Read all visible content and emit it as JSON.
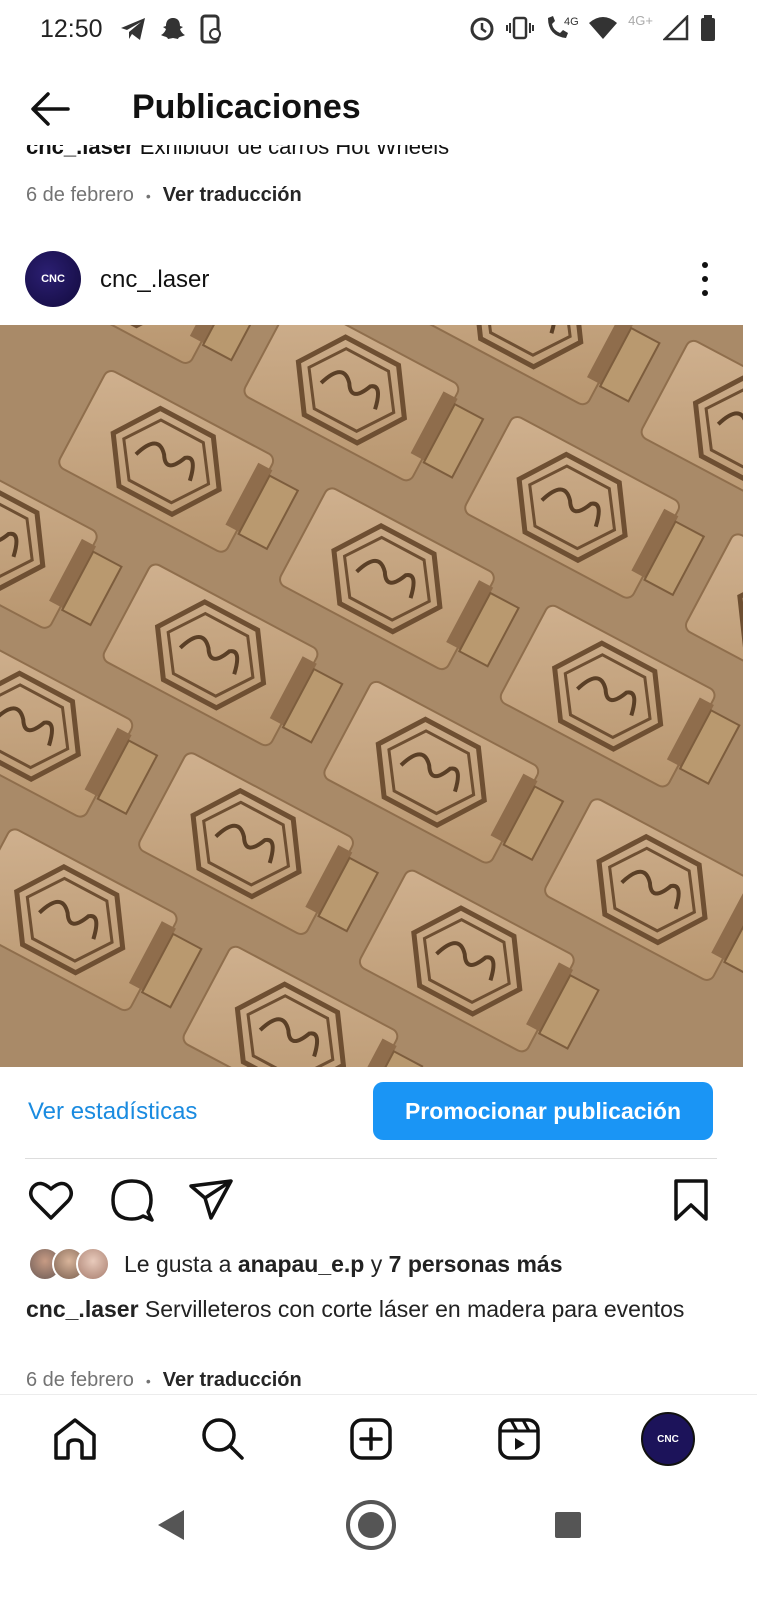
{
  "status_bar": {
    "time": "12:50",
    "network_1": "4G",
    "network_2": "4G+",
    "left_icons": [
      "telegram-icon",
      "snapchat-icon",
      "phone-sync-icon"
    ],
    "right_icons": [
      "alarm-icon",
      "vibrate-icon",
      "volte-call-icon",
      "wifi-icon",
      "signal-icon",
      "battery-icon"
    ]
  },
  "header": {
    "title": "Publicaciones",
    "back_icon": "arrow-left-icon"
  },
  "previous_post": {
    "username": "cnc_.laser",
    "caption": "Exhibidor de carros Hot Wheels",
    "date": "6 de febrero",
    "separator": "•",
    "translate_label": "Ver traducción"
  },
  "post": {
    "username": "cnc_.laser",
    "avatar_text": "CNC",
    "more_icon": "more-vertical-icon",
    "image_alt": "Laser-cut wooden napkin holders with hexagon monogram",
    "stats_label": "Ver estadísticas",
    "promote_label": "Promocionar publicación",
    "actions": [
      "heart-icon",
      "comment-icon",
      "share-icon",
      "bookmark-icon"
    ],
    "likes_prefix": "Le gusta a",
    "likes_user": "anapau_e.p",
    "likes_joiner": "y",
    "likes_others": "7 personas más",
    "caption_user": "cnc_.laser",
    "caption_text": "Servilleteros con corte láser en madera para eventos",
    "date": "6 de febrero",
    "separator": "•",
    "translate_label": "Ver traducción"
  },
  "bottom_nav": {
    "items": [
      "home-icon",
      "search-icon",
      "create-icon",
      "reels-icon",
      "profile-avatar"
    ],
    "profile_text": "CNC"
  },
  "system_nav": {
    "items": [
      "back-triangle-icon",
      "home-circle-icon",
      "recents-square-icon"
    ]
  },
  "colors": {
    "accent_blue": "#1a95f5",
    "link_blue": "#1a8be0",
    "wood": "#c8a987"
  }
}
